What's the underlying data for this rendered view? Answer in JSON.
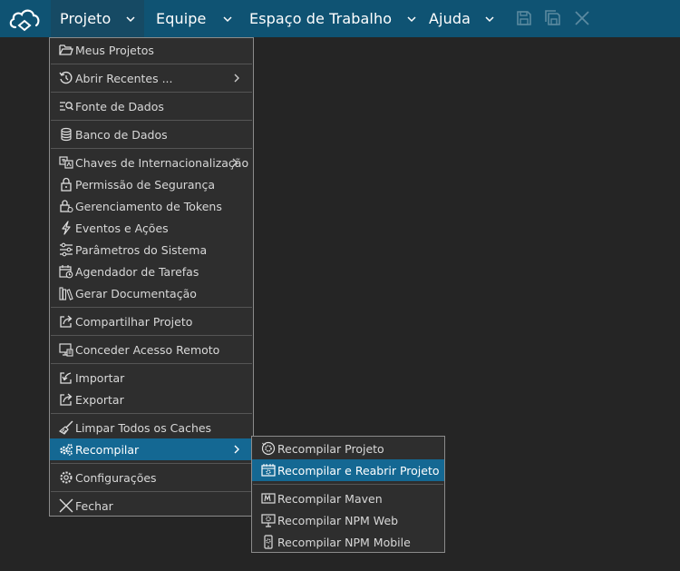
{
  "app": {
    "logo_icon": "cloud-logo-icon"
  },
  "topbar": {
    "menus": [
      {
        "label": "Projeto"
      },
      {
        "label": "Equipe"
      },
      {
        "label": "Espaço de Trabalho"
      },
      {
        "label": "Ajuda"
      }
    ],
    "icons": [
      "save-icon",
      "save-all-icon",
      "close-icon"
    ]
  },
  "projeto_menu": {
    "items": [
      {
        "label": "Meus Projetos",
        "icon": "folder-open-icon"
      },
      {
        "label": "Abrir Recentes ...",
        "icon": "history-icon",
        "submenu": true
      },
      {
        "label": "Fonte de Dados",
        "icon": "data-source-search-icon"
      },
      {
        "label": "Banco de Dados",
        "icon": "database-icon"
      },
      {
        "label": "Chaves de Internacionalização",
        "icon": "translate-icon",
        "submenu": true
      },
      {
        "label": "Permissão de Segurança",
        "icon": "lock-icon"
      },
      {
        "label": "Gerenciamento de Tokens",
        "icon": "token-lock-icon"
      },
      {
        "label": "Eventos e Ações",
        "icon": "lightning-icon"
      },
      {
        "label": "Parâmetros do Sistema",
        "icon": "sliders-icon"
      },
      {
        "label": "Agendador de Tarefas",
        "icon": "calendar-clock-icon"
      },
      {
        "label": "Gerar Documentação",
        "icon": "books-icon"
      },
      {
        "label": "Compartilhar Projeto",
        "icon": "share-icon"
      },
      {
        "label": "Conceder Acesso Remoto",
        "icon": "remote-access-icon"
      },
      {
        "label": "Importar",
        "icon": "import-icon"
      },
      {
        "label": "Exportar",
        "icon": "export-icon"
      },
      {
        "label": "Limpar Todos os Caches",
        "icon": "broom-icon"
      },
      {
        "label": "Recompilar",
        "icon": "gears-icon",
        "submenu": true,
        "highlighted": true
      },
      {
        "label": "Configurações",
        "icon": "settings-icon"
      },
      {
        "label": "Fechar",
        "icon": "close-x-icon"
      }
    ]
  },
  "recompilar_submenu": {
    "items": [
      {
        "label": "Recompilar Projeto",
        "icon": "recompile-icon"
      },
      {
        "label": "Recompilar e Reabrir Projeto",
        "icon": "recompile-reopen-icon",
        "highlighted": true
      },
      {
        "label": "Recompilar Maven",
        "icon": "maven-icon"
      },
      {
        "label": "Recompilar NPM Web",
        "icon": "npm-web-icon"
      },
      {
        "label": "Recompilar NPM Mobile",
        "icon": "npm-mobile-icon"
      }
    ]
  },
  "colors": {
    "topbar": "#0f5373",
    "background": "#252525",
    "menu_bg": "#2e2e2e",
    "highlight": "#146893"
  }
}
